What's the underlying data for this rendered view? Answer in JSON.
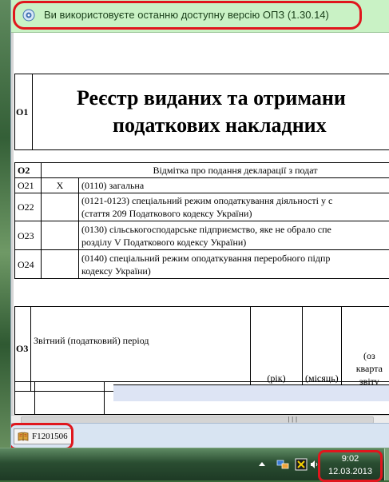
{
  "notification": {
    "text": "Ви використовуєте останню доступну версію ОПЗ (1.30.14)",
    "icon": "opz-update-icon"
  },
  "document": {
    "o1": {
      "code": "О1",
      "title_line1": "Реєстр виданих та отримани",
      "title_line2": "податкових накладних"
    },
    "o2": {
      "code": "О2",
      "header": "Відмітка про подання декларації з подат",
      "rows": [
        {
          "code": "О21",
          "mark": "X",
          "text1": "(0110) загальна",
          "text2": ""
        },
        {
          "code": "О22",
          "mark": "",
          "text1": "(0121-0123) спеціальний режим оподаткування діяльності у с",
          "text2": "(стаття 209 Податкового кодексу України)"
        },
        {
          "code": "О23",
          "mark": "",
          "text1": "(0130) сільськогосподарське підприємство, яке не обрало спе",
          "text2": "розділу V Податкового кодексу України)"
        },
        {
          "code": "О24",
          "mark": "",
          "text1": "(0140) спеціальний режим оподаткування переробного підпр",
          "text2": "кодексу України)"
        }
      ]
    },
    "o3": {
      "code": "О3",
      "label": "Звітний (податковий) період",
      "year_label": "(рік)",
      "month_label": "(місяць)",
      "quarter_line1": "(оз",
      "quarter_line2": "кварта",
      "quarter_line3": "звіту"
    }
  },
  "bottom_tab": {
    "label": "F1201506",
    "icon": "book-icon"
  },
  "scrollbar": {
    "grip": "|||"
  },
  "taskbar": {
    "time": "9:02",
    "date": "12.03.2013"
  },
  "colors": {
    "highlight_ring": "#e0161d",
    "notification_bg": "#c9f2c5",
    "bottom_bar": "#d8e4f2"
  }
}
